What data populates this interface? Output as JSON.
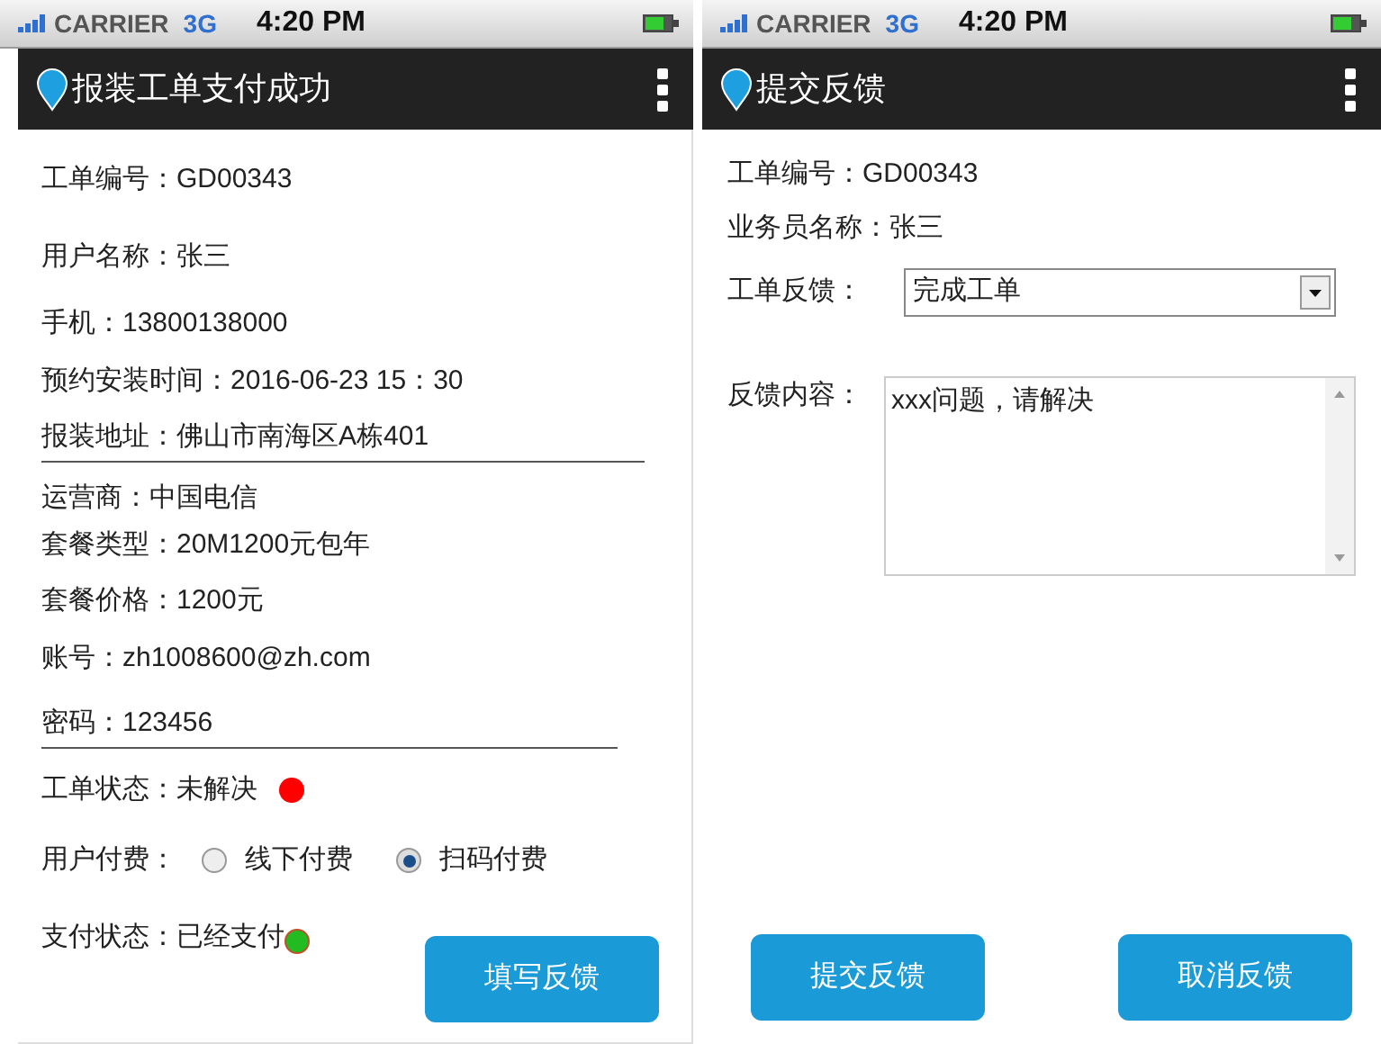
{
  "screens": [
    {
      "status_bar": {
        "carrier": "CARRIER",
        "network": "3G",
        "time": "4:20 PM"
      },
      "title": "报装工单支付成功",
      "rows": [
        {
          "kind": "text",
          "label": "工单编号：",
          "value": "GD00343",
          "divider_below": false
        },
        {
          "kind": "text",
          "label": "用户名称：",
          "value": "张三",
          "divider_below": false
        },
        {
          "kind": "text",
          "label": "手机：",
          "value": "13800138000",
          "divider_below": false
        },
        {
          "kind": "text",
          "label": "预约安装时间：",
          "value": "2016-06-23 15：30",
          "divider_below": false
        },
        {
          "kind": "text",
          "label": "报装地址：",
          "value": "佛山市南海区A栋401",
          "divider_below": true
        },
        {
          "kind": "text",
          "label": "运营商：",
          "value": "中国电信",
          "divider_below": false
        },
        {
          "kind": "text",
          "label": "套餐类型：",
          "value": "20M1200元包年",
          "divider_below": false
        },
        {
          "kind": "text",
          "label": "套餐价格：",
          "value": "1200元",
          "divider_below": false
        },
        {
          "kind": "text",
          "label": "账号：",
          "value": "zh1008600@zh.com",
          "divider_below": false
        },
        {
          "kind": "text",
          "label": "密码：",
          "value": "123456",
          "divider_below": true
        },
        {
          "kind": "status",
          "label": "工单状态：",
          "value": "未解决",
          "color": "#ff0000"
        },
        {
          "kind": "radio",
          "label": "用户付费：",
          "options": [
            {
              "label": "线下付费",
              "selected": false
            },
            {
              "label": "扫码付费",
              "selected": true
            }
          ]
        },
        {
          "kind": "status",
          "label": "支付状态：",
          "value": "已经支付",
          "color": "#22bb22"
        }
      ],
      "buttons": [
        "填写反馈"
      ]
    },
    {
      "status_bar": {
        "carrier": "CARRIER",
        "network": "3G",
        "time": "4:20 PM"
      },
      "title": "提交反馈",
      "rows": [
        {
          "kind": "text",
          "label": "工单编号：",
          "value": "GD00343"
        },
        {
          "kind": "text",
          "label": "业务员名称：",
          "value": "张三"
        },
        {
          "kind": "select",
          "label": "工单反馈：",
          "value": "完成工单"
        },
        {
          "kind": "textarea",
          "label": "反馈内容：",
          "value": "xxx问题，请解决"
        }
      ],
      "buttons": [
        "提交反馈",
        "取消反馈"
      ]
    }
  ]
}
